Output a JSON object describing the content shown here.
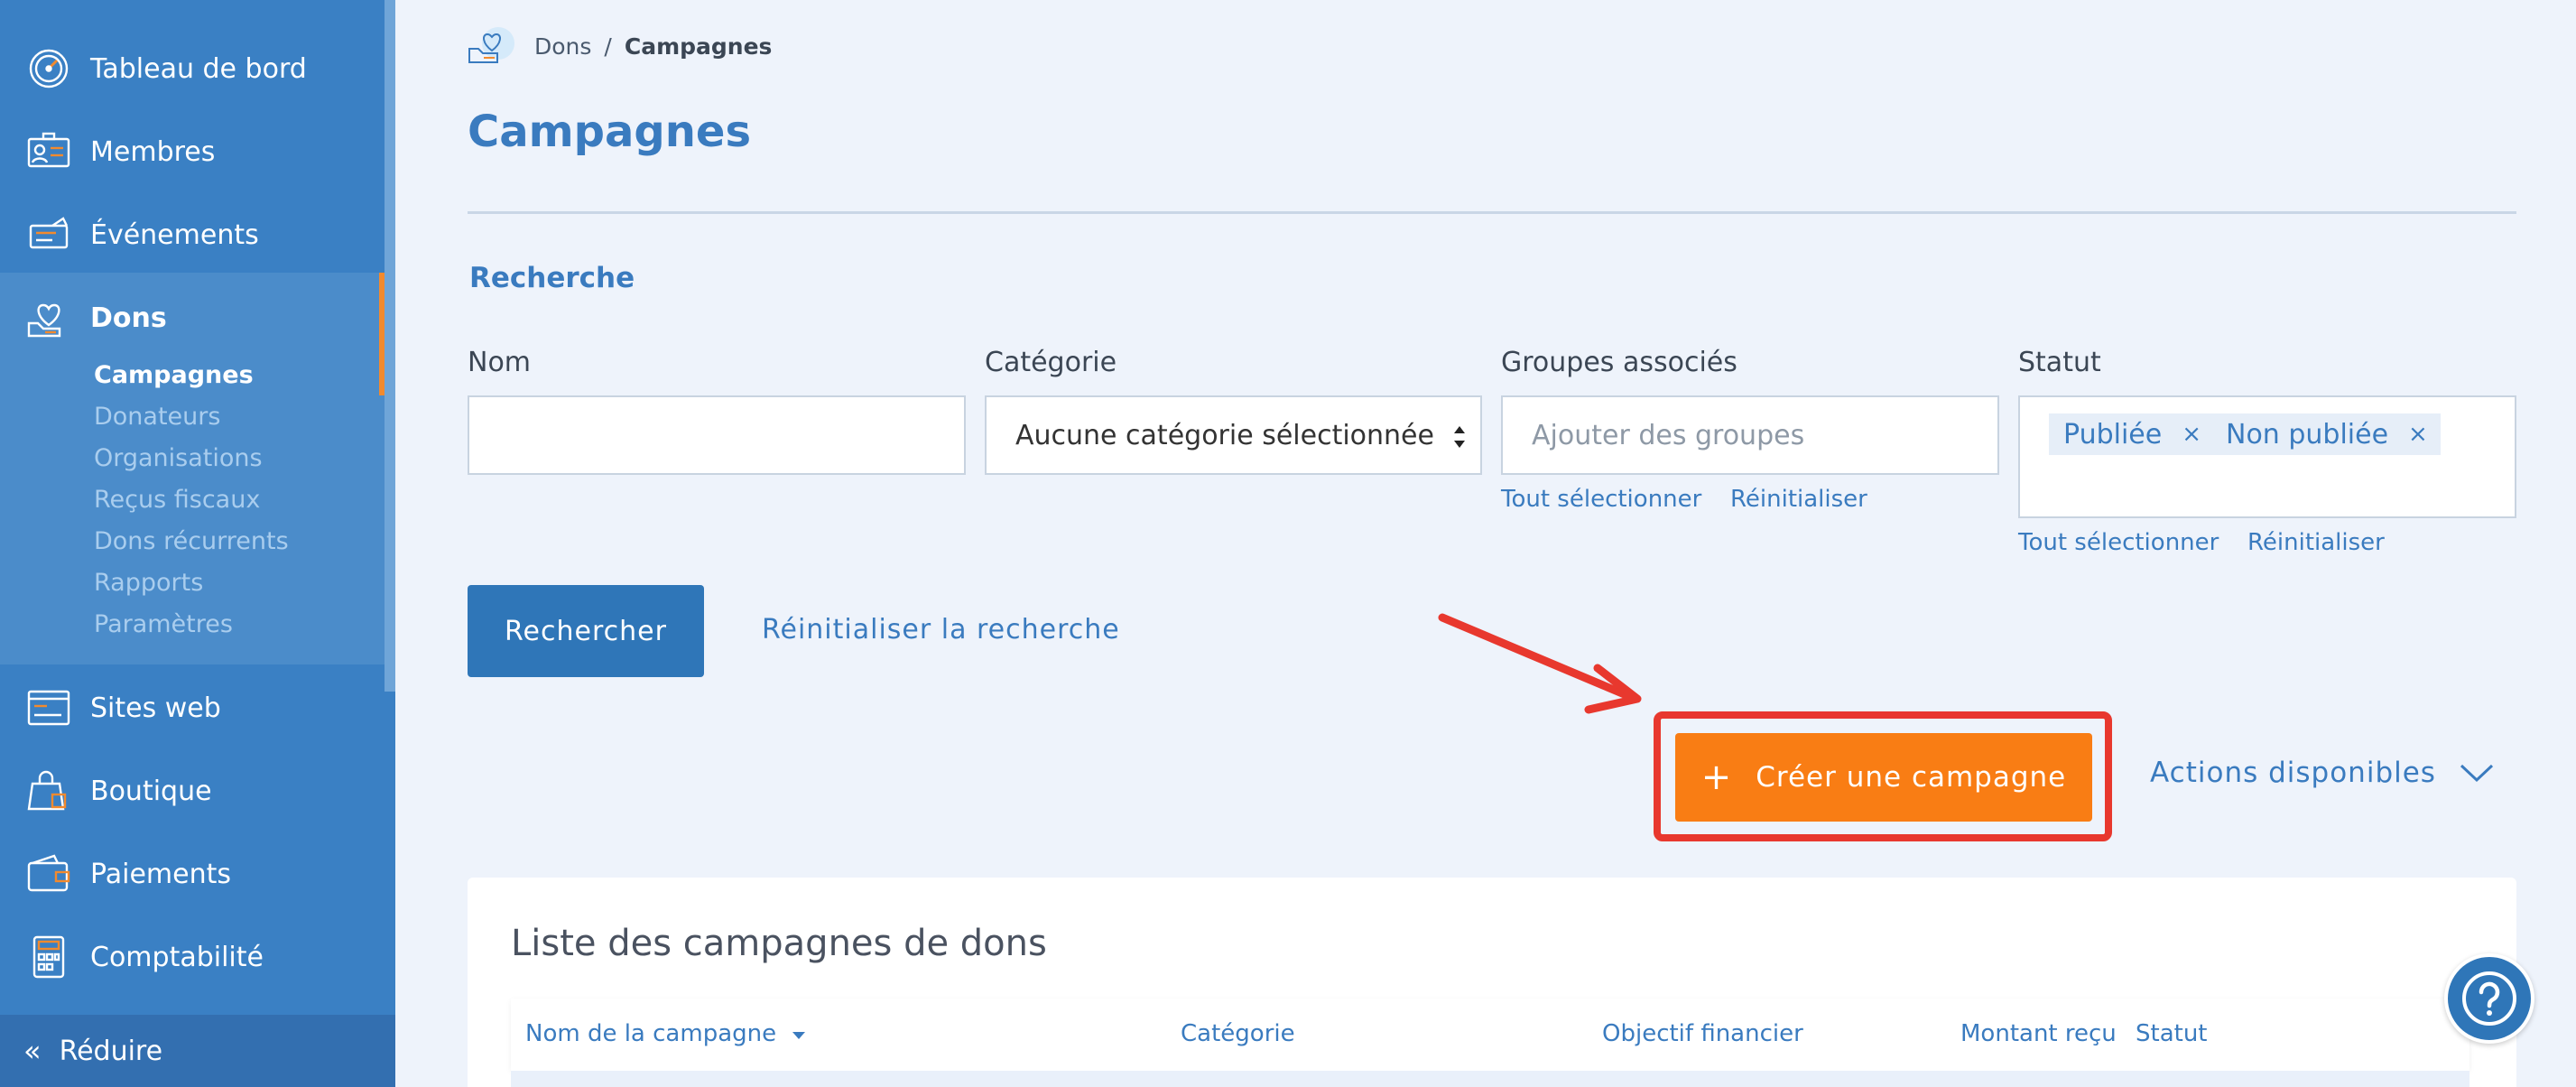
{
  "sidebar": {
    "items": [
      {
        "label": "Tableau de bord",
        "icon": "dashboard-gauge-icon"
      },
      {
        "label": "Membres",
        "icon": "members-card-icon"
      },
      {
        "label": "Événements",
        "icon": "ticket-icon"
      },
      {
        "label": "Dons",
        "icon": "heart-hand-icon"
      },
      {
        "label": "Sites web",
        "icon": "browser-window-icon"
      },
      {
        "label": "Boutique",
        "icon": "shopping-bag-icon"
      },
      {
        "label": "Paiements",
        "icon": "wallet-icon"
      },
      {
        "label": "Comptabilité",
        "icon": "calculator-icon"
      }
    ],
    "dons_sub": [
      {
        "label": "Campagnes",
        "active": true
      },
      {
        "label": "Donateurs"
      },
      {
        "label": "Organisations"
      },
      {
        "label": "Reçus fiscaux"
      },
      {
        "label": "Dons récurrents"
      },
      {
        "label": "Rapports"
      },
      {
        "label": "Paramètres"
      }
    ],
    "reduce_label": "Réduire"
  },
  "breadcrumb": {
    "parent": "Dons",
    "separator": "/",
    "current": "Campagnes"
  },
  "page_title": "Campagnes",
  "search": {
    "section_title": "Recherche",
    "name_label": "Nom",
    "name_value": "",
    "category_label": "Catégorie",
    "category_value": "Aucune catégorie sélectionnée",
    "groups_label": "Groupes associés",
    "groups_placeholder": "Ajouter des groupes",
    "groups_select_all": "Tout sélectionner",
    "groups_reset": "Réinitialiser",
    "status_label": "Statut",
    "status_tags": [
      "Publiée",
      "Non publiée"
    ],
    "status_remove": "×",
    "status_select_all": "Tout sélectionner",
    "status_reset": "Réinitialiser",
    "search_button": "Rechercher",
    "reset_search": "Réinitialiser la recherche"
  },
  "actions": {
    "create_plus": "+",
    "create_label": "Créer une campagne",
    "available_actions": "Actions disponibles"
  },
  "list": {
    "title": "Liste des campagnes de dons",
    "columns": [
      "Nom de la campagne",
      "Catégorie",
      "Objectif financier",
      "Montant reçu",
      "Statut"
    ]
  },
  "colors": {
    "sidebar": "#3a80c4",
    "accent_orange": "#f97d14",
    "highlight_red": "#e8382e",
    "primary_blue": "#2f76b8"
  }
}
